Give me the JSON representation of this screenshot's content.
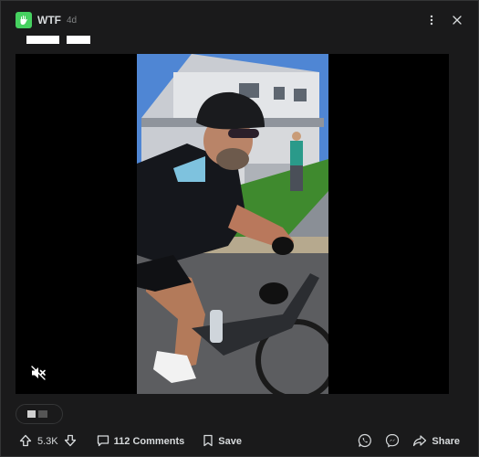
{
  "post": {
    "subreddit": "WTF",
    "age": "4d"
  },
  "footer": {
    "score": "5.3K",
    "comments_label": "112 Comments",
    "save_label": "Save",
    "share_label": "Share"
  },
  "icons": {
    "subreddit_avatar": "subreddit-icon",
    "more": "more-options-icon",
    "close": "close-icon",
    "mute": "muted-speaker-icon",
    "upvote": "upvote-arrow-icon",
    "downvote": "downvote-arrow-icon",
    "comments": "comment-icon",
    "save": "bookmark-icon",
    "whatsapp": "whatsapp-icon",
    "messenger": "messenger-icon",
    "share": "share-arrow-icon"
  },
  "colors": {
    "background": "#1a1a1b",
    "border": "#343536",
    "subreddit_accent": "#46d160",
    "text": "#d7dadc",
    "muted": "#818384"
  }
}
